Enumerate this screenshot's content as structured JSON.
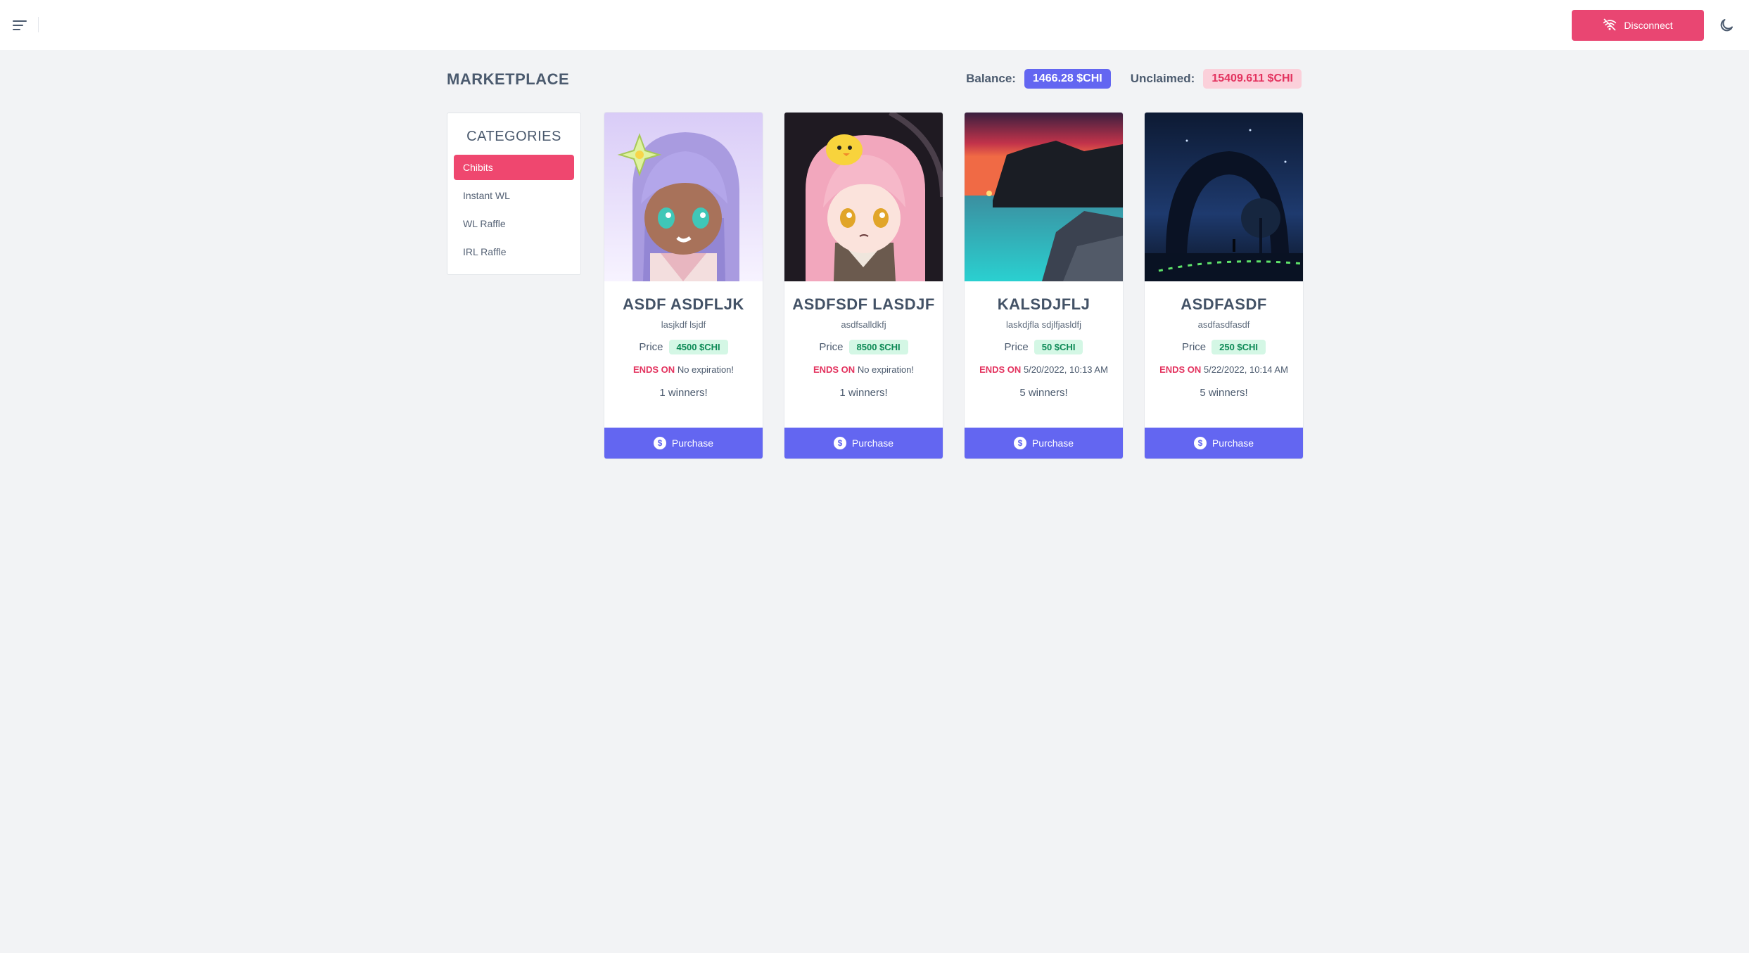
{
  "header": {
    "disconnect_label": "Disconnect",
    "icons": {
      "menu": "menu-lines-icon",
      "disconnect": "wifi-off-icon",
      "theme": "moon-icon"
    }
  },
  "page": {
    "title": "MARKETPLACE",
    "balance_label": "Balance:",
    "balance_value": "1466.28 $CHI",
    "unclaimed_label": "Unclaimed:",
    "unclaimed_value": "15409.611 $CHI"
  },
  "categories": {
    "title": "CATEGORIES",
    "items": [
      {
        "label": "Chibits",
        "active": true
      },
      {
        "label": "Instant WL",
        "active": false
      },
      {
        "label": "WL Raffle",
        "active": false
      },
      {
        "label": "IRL Raffle",
        "active": false
      }
    ]
  },
  "cards": [
    {
      "name": "ASDF ASDFLJK",
      "subtitle": "lasjkdf lsjdf",
      "price_label": "Price",
      "price": "4500 $CHI",
      "ends_label": "ENDS ON",
      "ends_value": "No expiration!",
      "winners": "1 winners!",
      "button_label": "Purchase",
      "image": "chibi-purple-hair"
    },
    {
      "name": "ASDFSDF LASDJF",
      "subtitle": "asdfsalldkfj",
      "price_label": "Price",
      "price": "8500 $CHI",
      "ends_label": "ENDS ON",
      "ends_value": "No expiration!",
      "winners": "1 winners!",
      "button_label": "Purchase",
      "image": "chibi-pink-hair"
    },
    {
      "name": "KALSDJFLJ",
      "subtitle": "laskdjfla sdjlfjasldfj",
      "price_label": "Price",
      "price": "50 $CHI",
      "ends_label": "ENDS ON",
      "ends_value": "5/20/2022, 10:13 AM",
      "winners": "5 winners!",
      "button_label": "Purchase",
      "image": "sunset-coast"
    },
    {
      "name": "ASDFASDF",
      "subtitle": "asdfasdfasdf",
      "price_label": "Price",
      "price": "250 $CHI",
      "ends_label": "ENDS ON",
      "ends_value": "5/22/2022, 10:14 AM",
      "winners": "5 winners!",
      "button_label": "Purchase",
      "image": "night-arch-landscape"
    }
  ],
  "colors": {
    "accent": "#6366f1",
    "danger": "#e94672",
    "category_active": "#ef476f",
    "price_bg": "#d4f7e5",
    "price_text": "#0d8a56"
  }
}
